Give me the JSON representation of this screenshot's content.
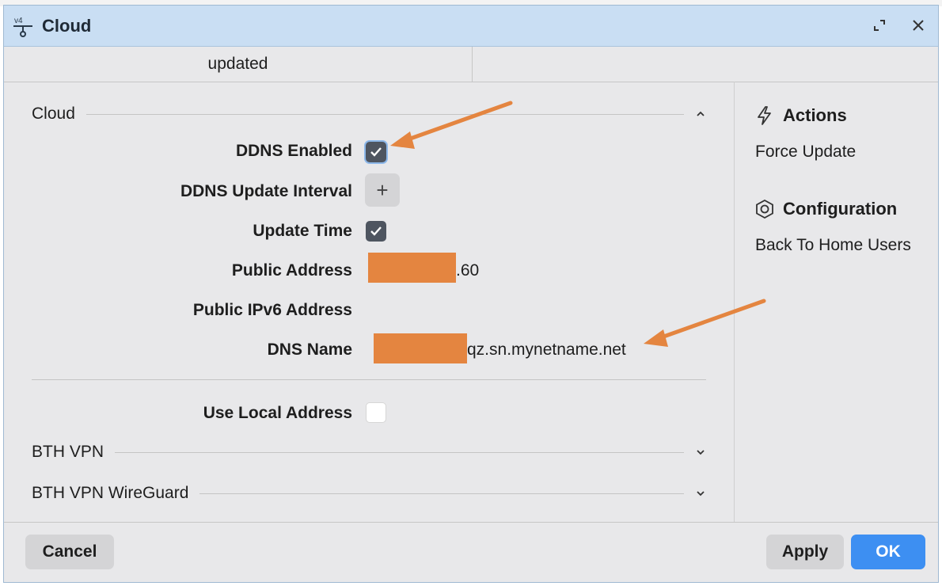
{
  "window": {
    "title": "Cloud",
    "tab_label": "updated"
  },
  "sections": {
    "cloud": "Cloud",
    "bth_vpn": "BTH VPN",
    "bth_vpn_wireguard": "BTH VPN WireGuard"
  },
  "fields": {
    "ddns_enabled": {
      "label": "DDNS Enabled",
      "checked": true
    },
    "ddns_update_interval": {
      "label": "DDNS Update Interval",
      "button": "+"
    },
    "update_time": {
      "label": "Update Time",
      "checked": true
    },
    "public_address": {
      "label": "Public Address",
      "value_suffix": ".60"
    },
    "public_ipv6_address": {
      "label": "Public IPv6 Address",
      "value": ""
    },
    "dns_name": {
      "label": "DNS Name",
      "value_suffix": "qz.sn.mynetname.net"
    },
    "use_local_address": {
      "label": "Use Local Address",
      "checked": false
    }
  },
  "sidebar": {
    "actions_title": "Actions",
    "actions_items": [
      "Force Update"
    ],
    "configuration_title": "Configuration",
    "configuration_items": [
      "Back To Home Users"
    ]
  },
  "footer": {
    "cancel": "Cancel",
    "apply": "Apply",
    "ok": "OK"
  },
  "colors": {
    "titlebar": "#c9def3",
    "annotation": "#e48540",
    "primary": "#3d8ff2"
  },
  "annotations": [
    "arrow pointing to DDNS Enabled checkbox",
    "arrow pointing to DNS Name value"
  ]
}
